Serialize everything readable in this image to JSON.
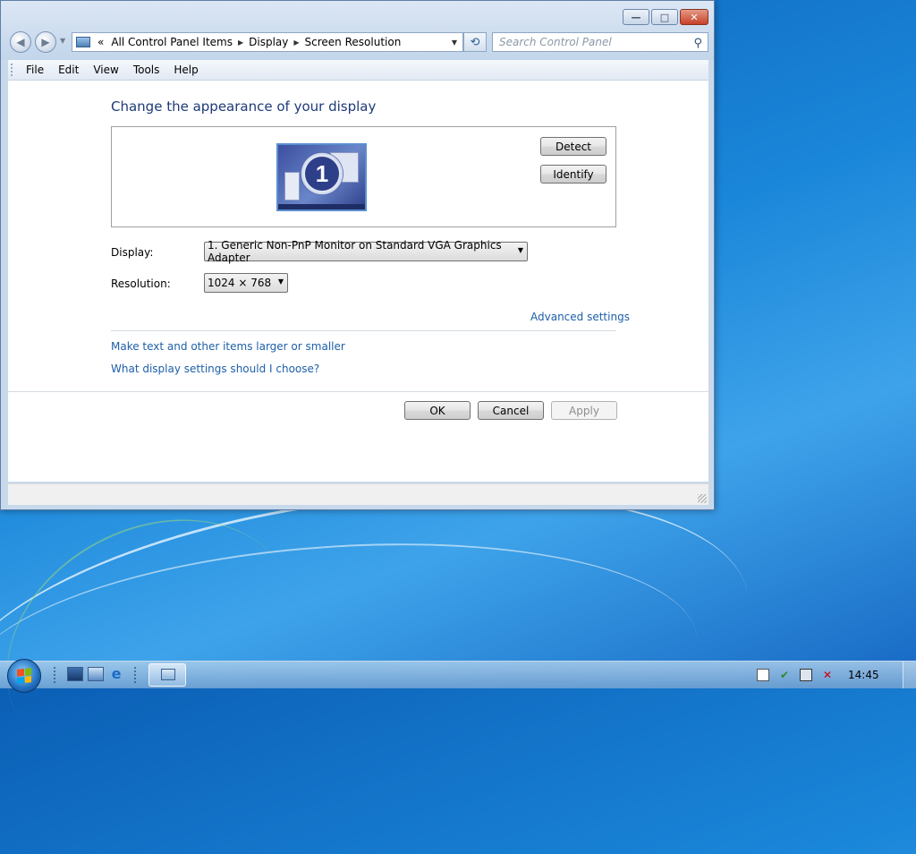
{
  "window": {
    "caption_buttons": {
      "minimize": "minimize-icon",
      "maximize": "maximize-icon",
      "close": "close-icon"
    }
  },
  "navigation": {
    "address_prefix": "«",
    "breadcrumbs": [
      "All Control Panel Items",
      "Display",
      "Screen Resolution"
    ],
    "search_placeholder": "Search Control Panel"
  },
  "menu": [
    "File",
    "Edit",
    "View",
    "Tools",
    "Help"
  ],
  "main": {
    "heading": "Change the appearance of your display",
    "monitor_number": "1",
    "detect_label": "Detect",
    "identify_label": "Identify",
    "display_label": "Display:",
    "display_value": "1. Generic Non-PnP Monitor on Standard VGA Graphics Adapter",
    "resolution_label": "Resolution:",
    "resolution_value": "1024 × 768",
    "advanced_link": "Advanced settings",
    "link_text_size": "Make text and other items larger or smaller",
    "link_help": "What display settings should I choose?",
    "ok_label": "OK",
    "cancel_label": "Cancel",
    "apply_label": "Apply"
  },
  "taskbar": {
    "quick_launch": [
      "show-desktop-icon",
      "switch-windows-icon",
      "internet-explorer-icon"
    ],
    "tray_icons": [
      "action-center-icon",
      "security-shield-icon",
      "network-icon",
      "volume-muted-icon"
    ],
    "clock": "14:45"
  },
  "colors": {
    "heading": "#1e3a78",
    "link": "#1e5fa8",
    "desktop": "#1a86d9"
  }
}
